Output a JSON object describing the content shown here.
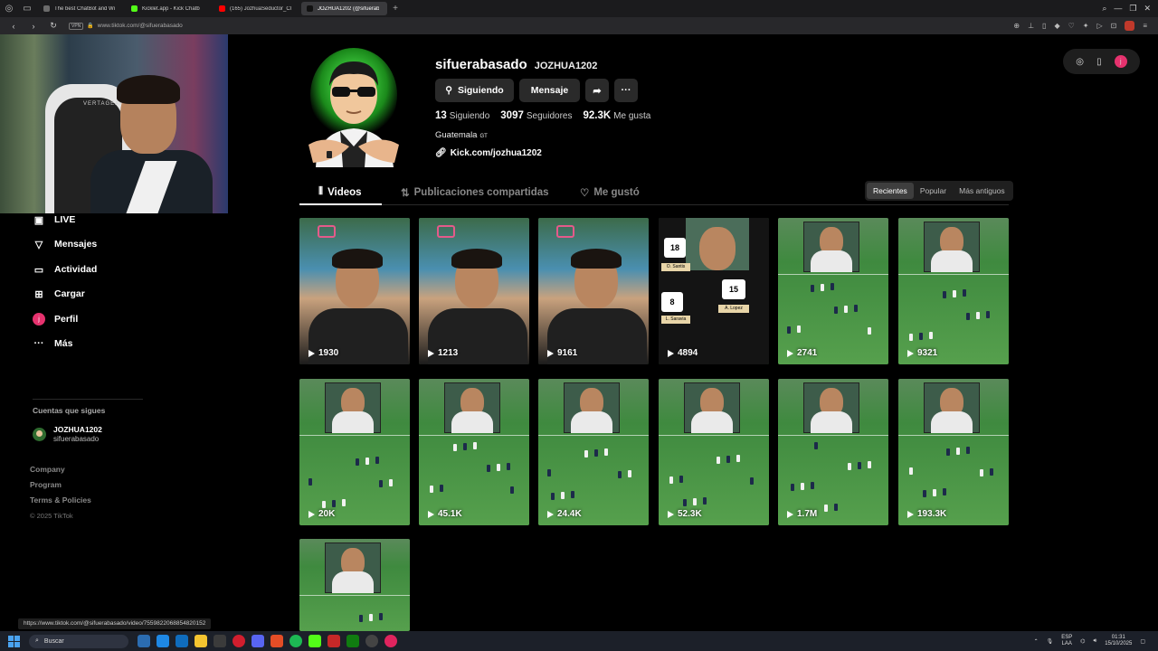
{
  "browser": {
    "tabs": [
      {
        "label": "The best ChatBot and Wi",
        "color": "#6b6b6b",
        "active": false
      },
      {
        "label": "Kicklet.app - Kick Chatb",
        "color": "#53fc18",
        "active": false
      },
      {
        "label": "(165) JozhuaSeductor_Cl",
        "color": "#ff0000",
        "active": false
      },
      {
        "label": "JOZHUA1202 (@sifuerab",
        "color": "#111111",
        "active": true
      }
    ],
    "url": "www.tiktok.com/@sifuerabasado",
    "vpn_label": "VPN"
  },
  "webcam": {
    "chair_brand": "VERTAGEAR"
  },
  "sidebar": {
    "nav": [
      {
        "label": "LIVE",
        "icon": "live-icon"
      },
      {
        "label": "Mensajes",
        "icon": "messages-icon"
      },
      {
        "label": "Actividad",
        "icon": "activity-icon"
      },
      {
        "label": "Cargar",
        "icon": "upload-icon"
      },
      {
        "label": "Perfil",
        "icon": "profile-icon"
      },
      {
        "label": "Más",
        "icon": "more-icon"
      }
    ],
    "profile_initial": "j",
    "following_title": "Cuentas que sigues",
    "following": [
      {
        "name": "JOZHUA1202",
        "username": "sifuerabasado"
      }
    ],
    "footer_links": [
      "Company",
      "Program",
      "Terms & Policies"
    ],
    "copyright": "© 2025 TikTok"
  },
  "profile": {
    "username": "sifuerabasado",
    "nickname": "JOZHUA1202",
    "follow_button": "Siguiendo",
    "message_button": "Mensaje",
    "stats": [
      {
        "value": "13",
        "label": "Siguiendo"
      },
      {
        "value": "3097",
        "label": "Seguidores"
      },
      {
        "value": "92.3K",
        "label": "Me gusta"
      }
    ],
    "bio": "Guatemala",
    "bio_flag": "GT",
    "link": "Kick.com/jozhua1202"
  },
  "tabs": [
    {
      "label": "Videos",
      "icon": "grid-icon",
      "active": true
    },
    {
      "label": "Publicaciones compartidas",
      "icon": "repost-icon",
      "active": false
    },
    {
      "label": "Me gustó",
      "icon": "liked-icon",
      "active": false
    }
  ],
  "sort": {
    "options": [
      "Recientes",
      "Popular",
      "Más antiguos"
    ],
    "selected": "Recientes"
  },
  "videos": [
    {
      "views": "1930",
      "kind": "face"
    },
    {
      "views": "1213",
      "kind": "face"
    },
    {
      "views": "9161",
      "kind": "face"
    },
    {
      "views": "4894",
      "kind": "lineup"
    },
    {
      "views": "2741",
      "kind": "pitch"
    },
    {
      "views": "9321",
      "kind": "pitch"
    },
    {
      "views": "20K",
      "kind": "pitch"
    },
    {
      "views": "45.1K",
      "kind": "pitch"
    },
    {
      "views": "24.4K",
      "kind": "pitch"
    },
    {
      "views": "52.3K",
      "kind": "pitch"
    },
    {
      "views": "1.7M",
      "kind": "pitch"
    },
    {
      "views": "193.3K",
      "kind": "pitch"
    },
    {
      "views": "",
      "kind": "pitch"
    }
  ],
  "lineup_labels": {
    "n1": "18",
    "p1": "O. Santis",
    "n2": "8",
    "p2": "L. Saravia",
    "n3": "15",
    "p3": "A. Lopez"
  },
  "status_bar_url": "https://www.tiktok.com/@sifuerabasado/video/7559822068854820152",
  "page_corner": "ox",
  "taskbar": {
    "search_placeholder": "Buscar",
    "lang_top": "ESP",
    "lang_bottom": "LAA",
    "time": "01:31",
    "date": "15/10/2025"
  }
}
